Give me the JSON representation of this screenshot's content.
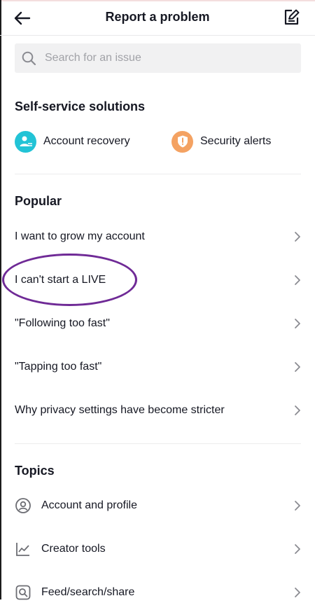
{
  "header": {
    "title": "Report a problem"
  },
  "search": {
    "placeholder": "Search for an issue"
  },
  "self_service": {
    "title": "Self-service solutions",
    "items": [
      {
        "label": "Account recovery",
        "icon": "account-recovery-icon",
        "color": "#22c3d6"
      },
      {
        "label": "Security alerts",
        "icon": "security-shield-icon",
        "color": "#f4a262"
      }
    ]
  },
  "popular": {
    "title": "Popular",
    "items": [
      {
        "label": "I want to grow my account"
      },
      {
        "label": "I can't start a LIVE"
      },
      {
        "label": "\"Following too fast\""
      },
      {
        "label": "\"Tapping too fast\""
      },
      {
        "label": "Why privacy settings have become stricter"
      }
    ]
  },
  "topics": {
    "title": "Topics",
    "items": [
      {
        "label": "Account and profile",
        "icon": "user-circle-icon"
      },
      {
        "label": "Creator tools",
        "icon": "line-chart-icon"
      },
      {
        "label": "Feed/search/share",
        "icon": "search-box-icon"
      }
    ]
  },
  "highlight_color": "#6f2a96"
}
